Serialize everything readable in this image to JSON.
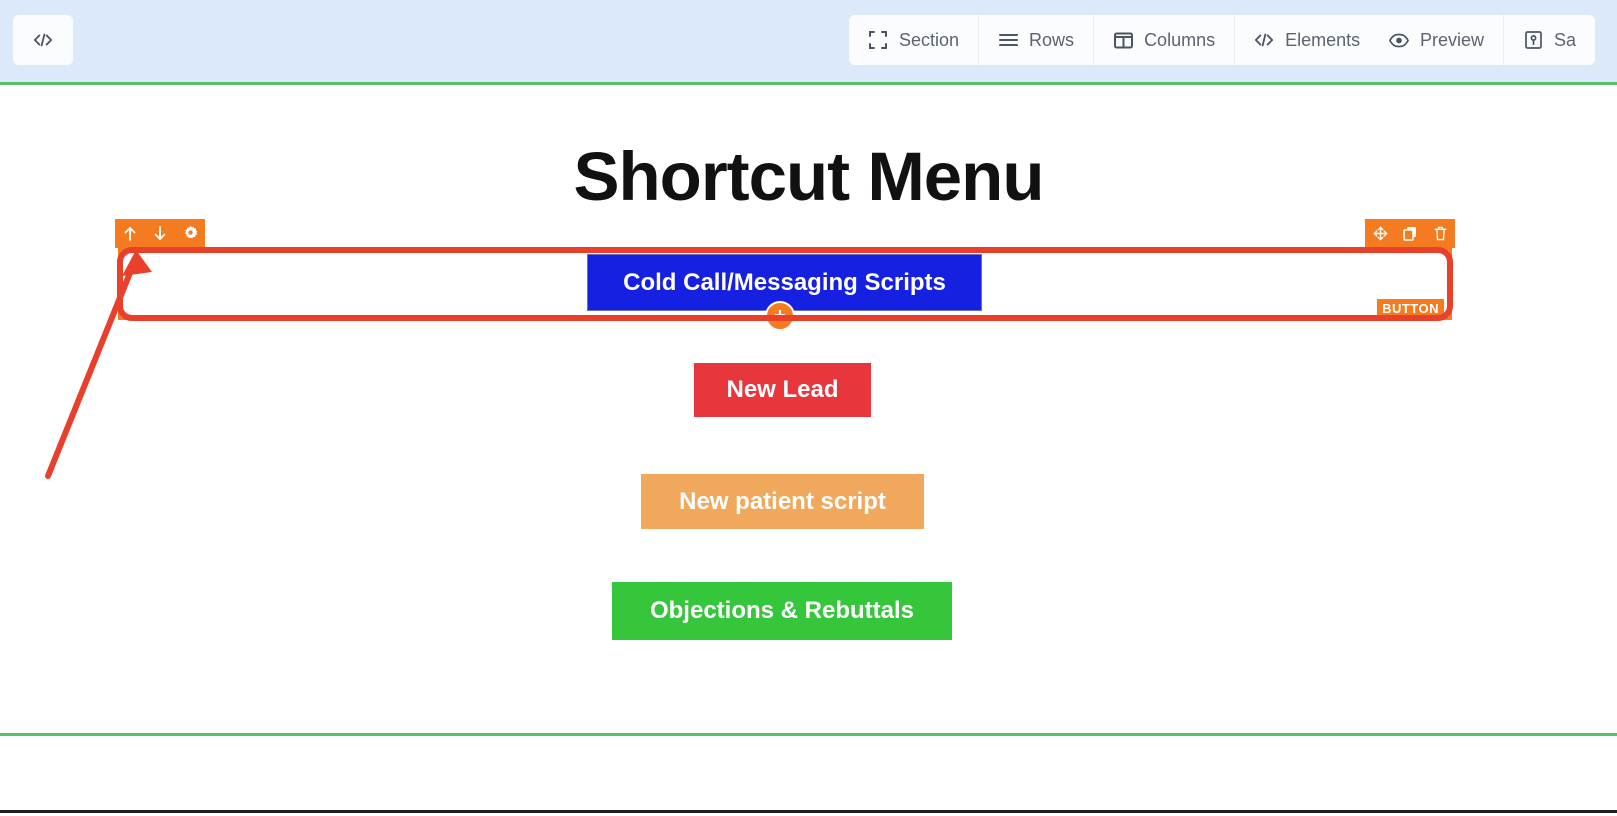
{
  "toolbar": {
    "code_button": {
      "name": "code-icon",
      "label": ""
    },
    "structure_group": [
      {
        "icon": "section-icon",
        "label": "Section"
      },
      {
        "icon": "rows-icon",
        "label": "Rows"
      },
      {
        "icon": "columns-icon",
        "label": "Columns"
      },
      {
        "icon": "code-icon",
        "label": "Elements"
      }
    ],
    "actions_group": [
      {
        "icon": "eye-icon",
        "label": "Preview"
      },
      {
        "icon": "save-icon",
        "label": "Sa"
      }
    ]
  },
  "canvas": {
    "page_title": "Shortcut Menu",
    "selected_row": {
      "element_label": "Cold Call/Messaging Scripts",
      "element_type_tag": "BUTTON",
      "add_element_label": "+",
      "left_controls": [
        {
          "icon": "arrow-up-icon",
          "title": "Move row up"
        },
        {
          "icon": "arrow-down-icon",
          "title": "Move row down"
        },
        {
          "icon": "gear-icon",
          "title": "Row settings"
        }
      ],
      "right_controls": [
        {
          "icon": "move-icon",
          "title": "Drag row"
        },
        {
          "icon": "duplicate-icon",
          "title": "Duplicate row"
        },
        {
          "icon": "trash-icon",
          "title": "Delete row"
        }
      ]
    },
    "buttons": [
      {
        "label": "New Lead",
        "color": "#e8363d"
      },
      {
        "label": "New patient script",
        "color": "#f0a85c"
      },
      {
        "label": "Objections & Rebuttals",
        "color": "#36c63b"
      }
    ]
  },
  "colors": {
    "toolbar_bg": "#dbe9fb",
    "section_rule": "#56c168",
    "row_accent": "#f47b20",
    "element_blue": "#1620e0",
    "annotation_red": "#e8402a"
  }
}
